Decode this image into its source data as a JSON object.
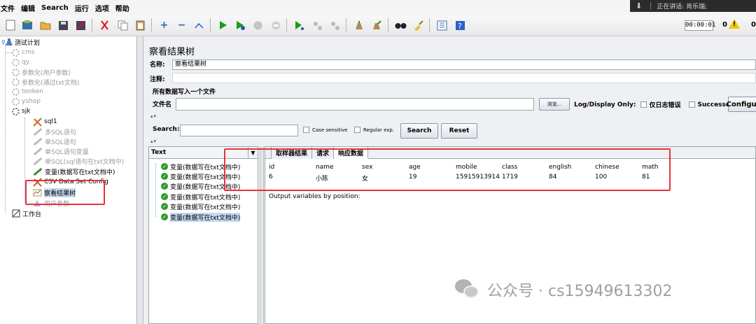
{
  "menubar": {
    "items": [
      "文件",
      "编辑",
      "Search",
      "运行",
      "选项",
      "帮助"
    ],
    "speaking_label": "正在讲话: 肖乐瑞;"
  },
  "toolbar": {
    "timer": "00:00:01",
    "warning_count": "0",
    "error_count": "0"
  },
  "tree": {
    "root": "测试计划",
    "nodes": [
      {
        "label": "cms"
      },
      {
        "label": "qy"
      },
      {
        "label": "参数化(用户参数)"
      },
      {
        "label": "参数化(通过txt文档)"
      },
      {
        "label": "tonken"
      },
      {
        "label": "yshop"
      },
      {
        "label": "sjk"
      }
    ],
    "sjk_children": [
      {
        "label": "sql1"
      },
      {
        "label": "多SQL语句"
      },
      {
        "label": "单SQL语句"
      },
      {
        "label": "单SQL语句变量"
      },
      {
        "label": "单SQL(sql语句在txt文档中)"
      },
      {
        "label": "变量(数据写在txt文档中)"
      },
      {
        "label": "CSV Data Set Config"
      },
      {
        "label": "察看结果树"
      },
      {
        "label": "用户参数"
      }
    ],
    "workbench": "工作台"
  },
  "panel": {
    "title": "察看结果树",
    "name_label": "名称:",
    "name_value": "察看结果树",
    "comment_label": "注释:",
    "section_title": "所有数据写入一个文件",
    "file_label": "文件名",
    "browse": "浏览...",
    "log_display_label": "Log/Display Only:",
    "errors_only": "仅日志错误",
    "successes": "Successes",
    "configure": "Configure"
  },
  "search": {
    "label": "Search:",
    "case_sensitive": "Case sensitive",
    "regex": "Regular exp.",
    "search_btn": "Search",
    "reset_btn": "Reset"
  },
  "results": {
    "renderer": "Text",
    "items": [
      "变量(数据写在txt文档中)",
      "变量(数据写在txt文档中)",
      "变量(数据写在txt文档中)",
      "变量(数据写在txt文档中)",
      "变量(数据写在txt文档中)",
      "变量(数据写在txt文档中)"
    ],
    "tabs": [
      "取样器结果",
      "请求",
      "响应数据"
    ],
    "table": {
      "headers": [
        "id",
        "name",
        "sex",
        "age",
        "mobile",
        "class",
        "english",
        "chinese",
        "math"
      ],
      "row": [
        "6",
        "小陈",
        "女",
        "19",
        "15915913914",
        "1719",
        "84",
        "100",
        "81"
      ]
    },
    "output_note": "Output variables by position:"
  },
  "watermark": "公众号 · cs15949613302"
}
